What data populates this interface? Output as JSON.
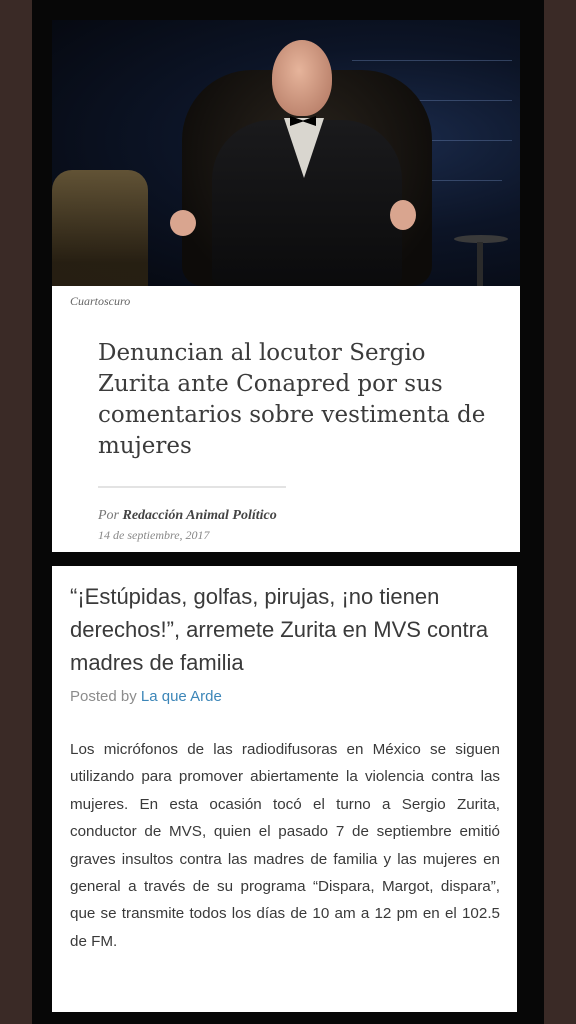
{
  "article1": {
    "image_credit": "Cuartoscuro",
    "headline": "Denuncian al locutor Sergio Zurita ante Conapred por sus comentarios sobre vestimenta de mujeres",
    "byline_prefix": "Por ",
    "author": "Redacción Animal Político",
    "date": "14 de septiembre, 2017"
  },
  "article2": {
    "title": "“¡Estúpidas, golfas, pirujas, ¡no tienen derechos!”, arremete Zurita en MVS contra madres de familia",
    "posted_prefix": "Posted by ",
    "posted_author": "La que Arde",
    "body": "Los micrófonos de las radiodifusoras en México se siguen utilizando para promover abiertamente la violencia contra las mujeres. En esta ocasión tocó el turno a Sergio Zurita, conductor de MVS, quien el pasado 7 de septiembre emitió graves insultos contra las madres de familia y las mujeres en general a través de su programa “Dispara, Margot, dispara”, que se transmite todos los días de 10 am a 12 pm en el 102.5 de FM."
  },
  "colors": {
    "page_bg": "#3a2a26",
    "frame_bg": "#070707",
    "link": "#3c86b8"
  }
}
